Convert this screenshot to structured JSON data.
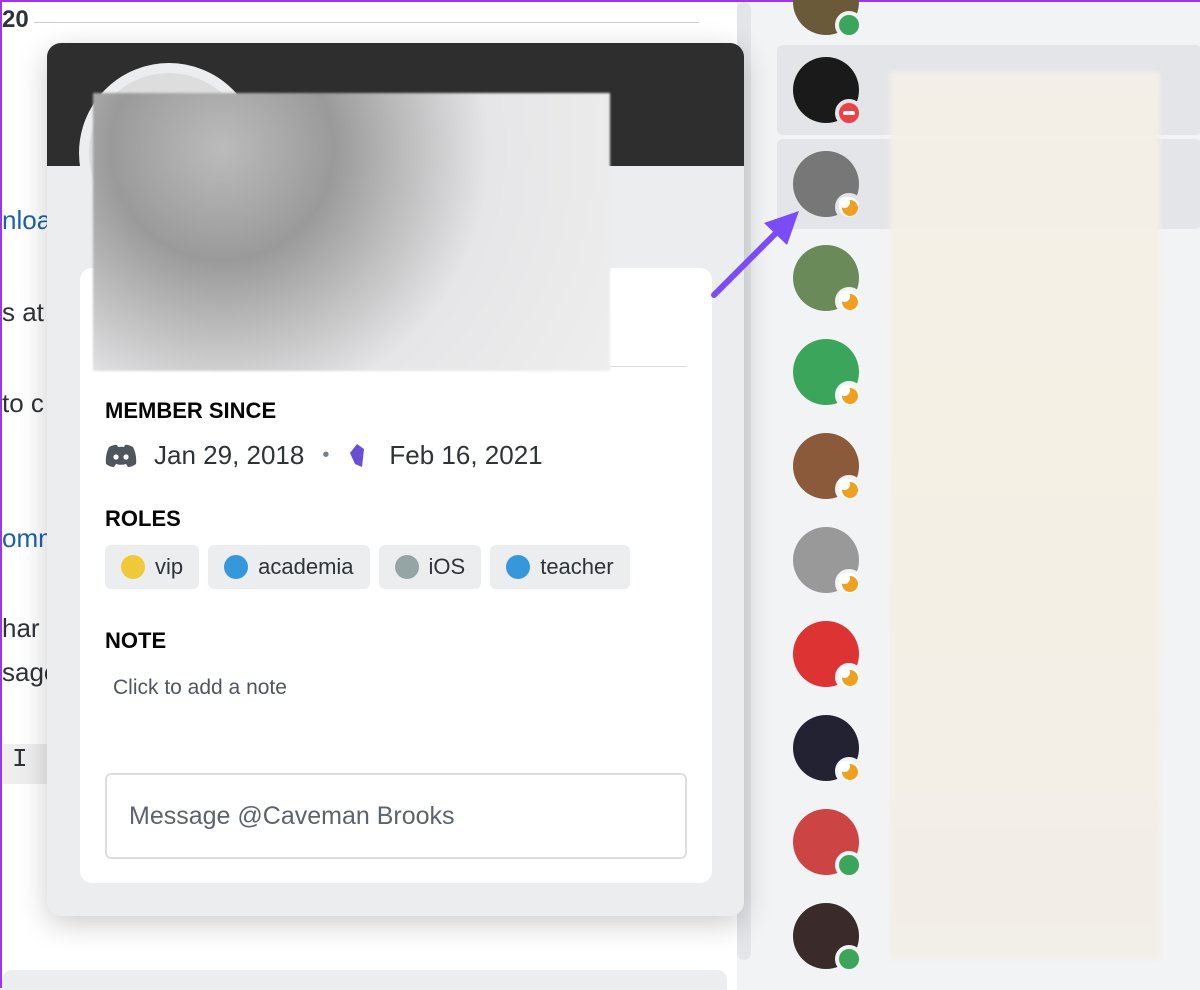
{
  "background_chat": {
    "fragments": [
      "20",
      "nloa",
      "s at",
      "to c",
      "omm",
      "har",
      "sage",
      "I"
    ]
  },
  "profile": {
    "member_since_label": "MEMBER SINCE",
    "discord_date": "Jan 29, 2018",
    "separator": "•",
    "server_date": "Feb 16, 2021",
    "roles_label": "ROLES",
    "roles": [
      {
        "name": "vip",
        "color": "#f0c93a"
      },
      {
        "name": "academia",
        "color": "#3498db"
      },
      {
        "name": "iOS",
        "color": "#95a5a6"
      },
      {
        "name": "teacher",
        "color": "#3498db"
      }
    ],
    "note_label": "NOTE",
    "note_placeholder": "Click to add a note",
    "message_placeholder": "Message @Caveman Brooks"
  },
  "members": [
    {
      "status": "online",
      "highlighted": false,
      "avatar": "#6b5a3a"
    },
    {
      "status": "dnd",
      "highlighted": true,
      "avatar": "#1a1a1a"
    },
    {
      "status": "idle",
      "highlighted": true,
      "avatar": "#777"
    },
    {
      "status": "idle",
      "highlighted": false,
      "avatar": "#6a8a5a"
    },
    {
      "status": "idle",
      "highlighted": false,
      "avatar": "#3ba55c"
    },
    {
      "status": "idle",
      "highlighted": false,
      "avatar": "#8a5a3a"
    },
    {
      "status": "idle",
      "highlighted": false,
      "avatar": "#999"
    },
    {
      "status": "idle",
      "highlighted": false,
      "avatar": "#d33"
    },
    {
      "status": "idle",
      "highlighted": false,
      "avatar": "#223"
    },
    {
      "status": "online",
      "highlighted": false,
      "avatar": "#c44"
    },
    {
      "status": "online",
      "highlighted": false,
      "avatar": "#3a2a2a"
    }
  ],
  "colors": {
    "online": "#3ba55c",
    "idle": "#f0a020",
    "dnd": "#ed4245",
    "arrow": "#7b4cf5"
  }
}
